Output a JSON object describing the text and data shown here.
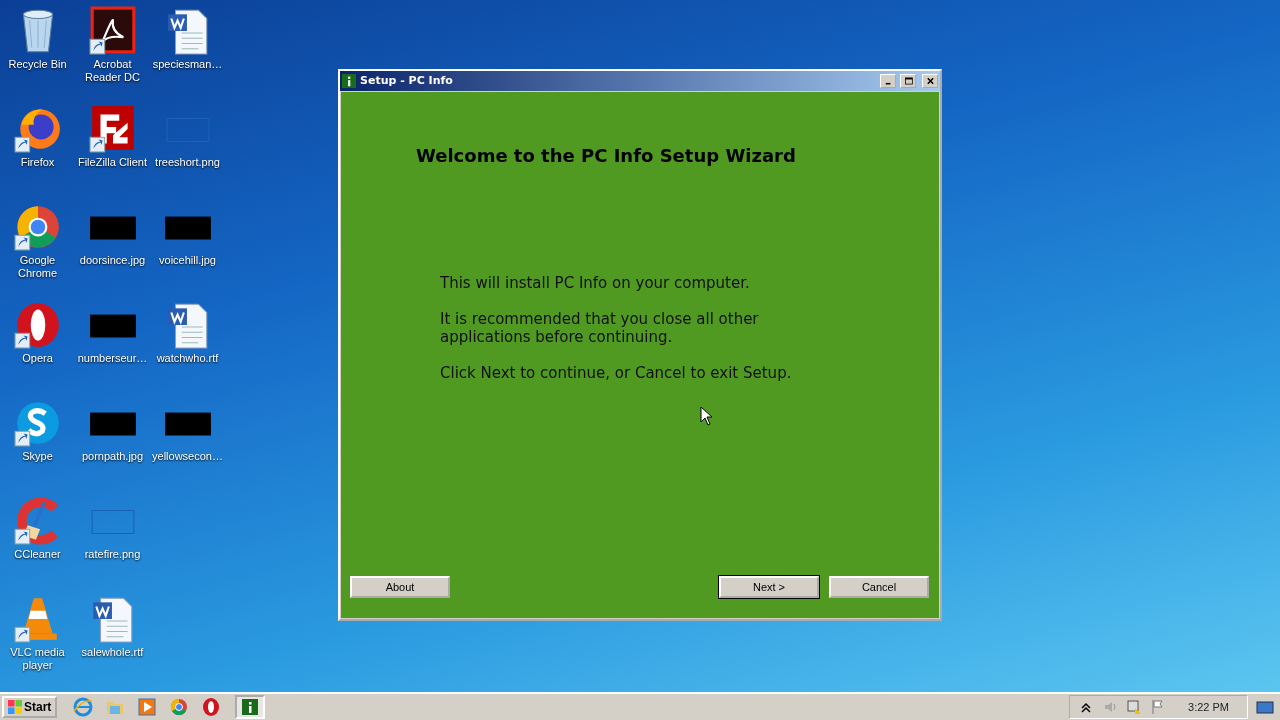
{
  "desktop_icons": [
    {
      "label": "Recycle Bin",
      "kind": "recycle",
      "shortcut": false
    },
    {
      "label": "Firefox",
      "kind": "firefox",
      "shortcut": true
    },
    {
      "label": "Google Chrome",
      "kind": "chrome",
      "shortcut": true
    },
    {
      "label": "Opera",
      "kind": "opera",
      "shortcut": true
    },
    {
      "label": "Skype",
      "kind": "skype",
      "shortcut": true
    },
    {
      "label": "CCleaner",
      "kind": "ccleaner",
      "shortcut": true
    },
    {
      "label": "VLC media player",
      "kind": "vlc",
      "shortcut": true
    },
    {
      "label": "Acrobat Reader DC",
      "kind": "acrobat",
      "shortcut": true
    },
    {
      "label": "FileZilla Client",
      "kind": "filezilla",
      "shortcut": true
    },
    {
      "label": "doorsince.jpg",
      "kind": "dark-image",
      "shortcut": false
    },
    {
      "label": "numberseur…",
      "kind": "dark-image",
      "shortcut": false
    },
    {
      "label": "pornpath.jpg",
      "kind": "dark-image",
      "shortcut": false
    },
    {
      "label": "ratefire.png",
      "kind": "blank-image",
      "shortcut": false
    },
    {
      "label": "salewhole.rtf",
      "kind": "document",
      "shortcut": false
    },
    {
      "label": "speciesman…",
      "kind": "document",
      "shortcut": false
    },
    {
      "label": "treeshort.png",
      "kind": "blank-image",
      "shortcut": false
    },
    {
      "label": "voicehill.jpg",
      "kind": "dark-image",
      "shortcut": false
    },
    {
      "label": "watchwho.rtf",
      "kind": "document",
      "shortcut": false
    },
    {
      "label": "yellowsecon…",
      "kind": "dark-image",
      "shortcut": false
    }
  ],
  "window": {
    "title": "Setup - PC Info",
    "heading": "Welcome to the PC Info Setup Wizard",
    "paragraphs": [
      "This will install PC Info on your computer.",
      "It is recommended that you close all other applications before continuing.",
      "Click Next to continue, or Cancel to exit Setup."
    ],
    "buttons": [
      {
        "label": "About",
        "default": false
      },
      {
        "label": "Next >",
        "default": true
      },
      {
        "label": "Cancel",
        "default": false
      }
    ]
  },
  "taskbar": {
    "start_label": "Start",
    "quick_launch": [
      {
        "kind": "ie"
      },
      {
        "kind": "folder"
      },
      {
        "kind": "media"
      },
      {
        "kind": "chrome"
      },
      {
        "kind": "opera"
      }
    ],
    "tasks": [
      {
        "kind": "setup",
        "selected": true
      }
    ],
    "tray": [
      {
        "kind": "chevron"
      },
      {
        "kind": "speaker"
      },
      {
        "kind": "network"
      },
      {
        "kind": "flag"
      }
    ],
    "clock": "3:22 PM"
  }
}
